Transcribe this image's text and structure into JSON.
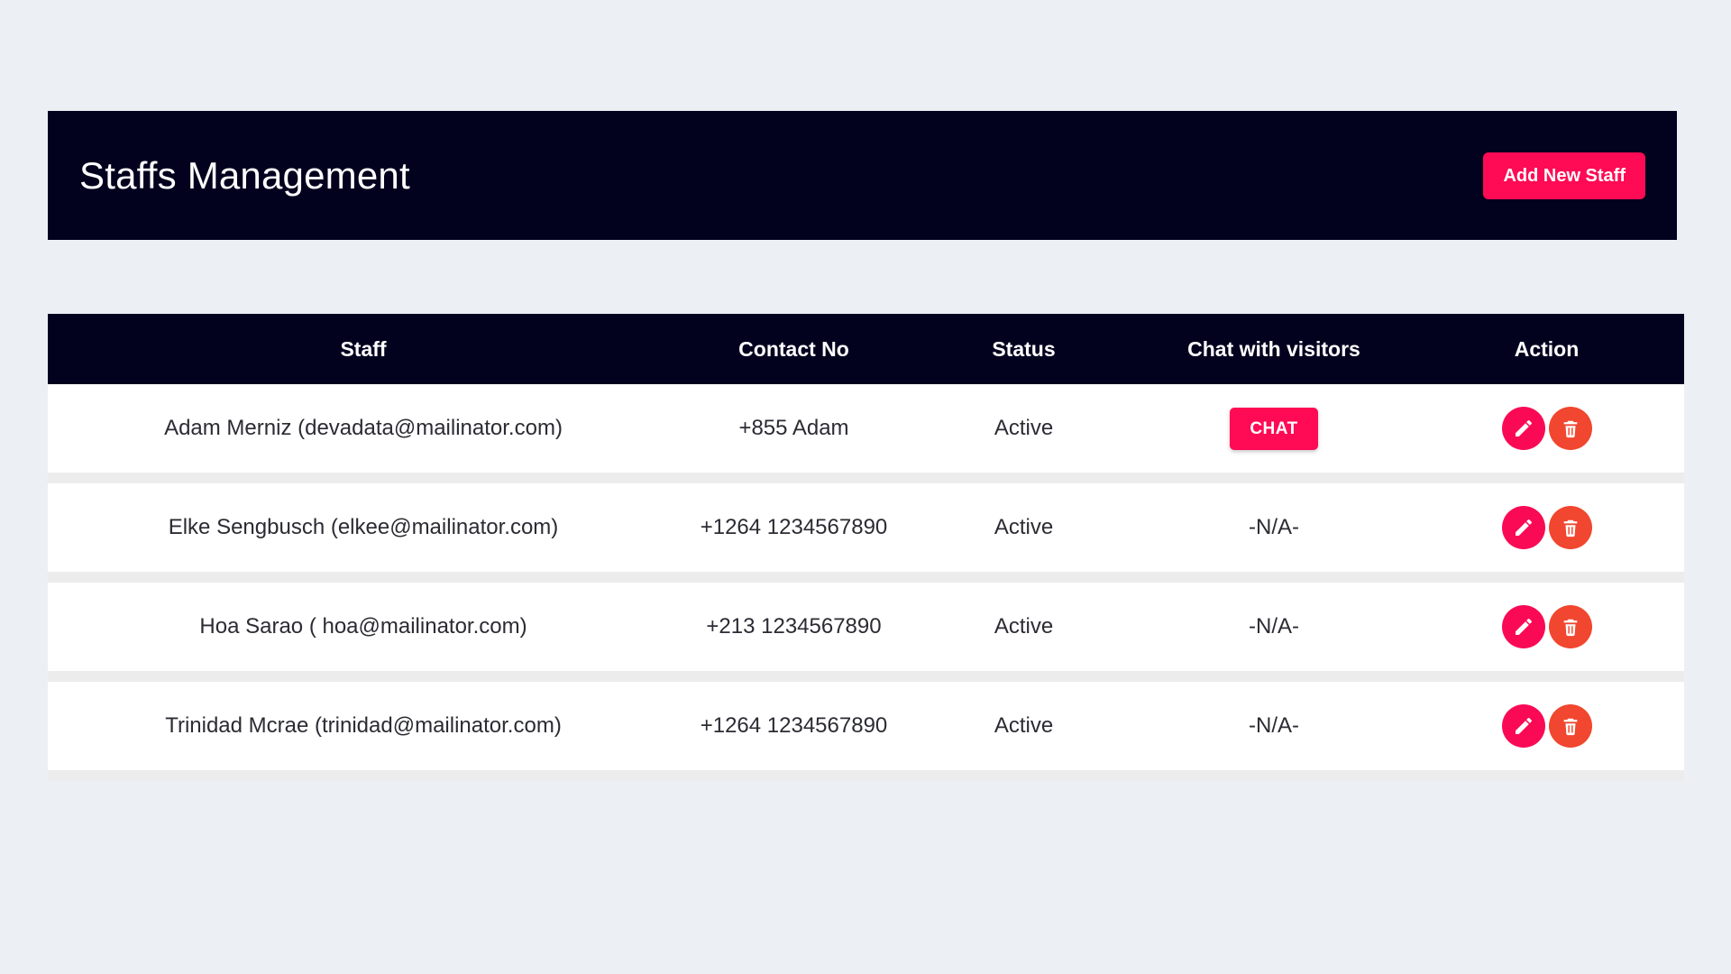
{
  "header": {
    "title": "Staffs Management",
    "add_button_label": "Add New Staff"
  },
  "colors": {
    "page_background": "#eceff4",
    "banner_background": "#02021f",
    "accent_pink": "#ff0a54",
    "delete_red": "#f1462f",
    "row_background": "#ffffff",
    "row_spacer": "#ececec",
    "text_dark": "#2b2b33"
  },
  "table": {
    "columns": [
      {
        "key": "staff",
        "label": "Staff"
      },
      {
        "key": "contact",
        "label": "Contact No"
      },
      {
        "key": "status",
        "label": "Status"
      },
      {
        "key": "chat",
        "label": "Chat with visitors"
      },
      {
        "key": "action",
        "label": "Action"
      }
    ],
    "rows": [
      {
        "staff": "Adam Merniz (devadata@mailinator.com)",
        "contact": "+855 Adam",
        "status": "Active",
        "chat_type": "button",
        "chat": "CHAT",
        "edit_icon": "pencil-icon",
        "delete_icon": "trash-icon"
      },
      {
        "staff": "Elke Sengbusch (elkee@mailinator.com)",
        "contact": "+1264 1234567890",
        "status": "Active",
        "chat_type": "text",
        "chat": "-N/A-",
        "edit_icon": "pencil-icon",
        "delete_icon": "trash-icon"
      },
      {
        "staff": "Hoa Sarao ( hoa@mailinator.com)",
        "contact": "+213 1234567890",
        "status": "Active",
        "chat_type": "text",
        "chat": "-N/A-",
        "edit_icon": "pencil-icon",
        "delete_icon": "trash-icon"
      },
      {
        "staff": "Trinidad Mcrae (trinidad@mailinator.com)",
        "contact": "+1264 1234567890",
        "status": "Active",
        "chat_type": "text",
        "chat": "-N/A-",
        "edit_icon": "pencil-icon",
        "delete_icon": "trash-icon"
      }
    ]
  }
}
